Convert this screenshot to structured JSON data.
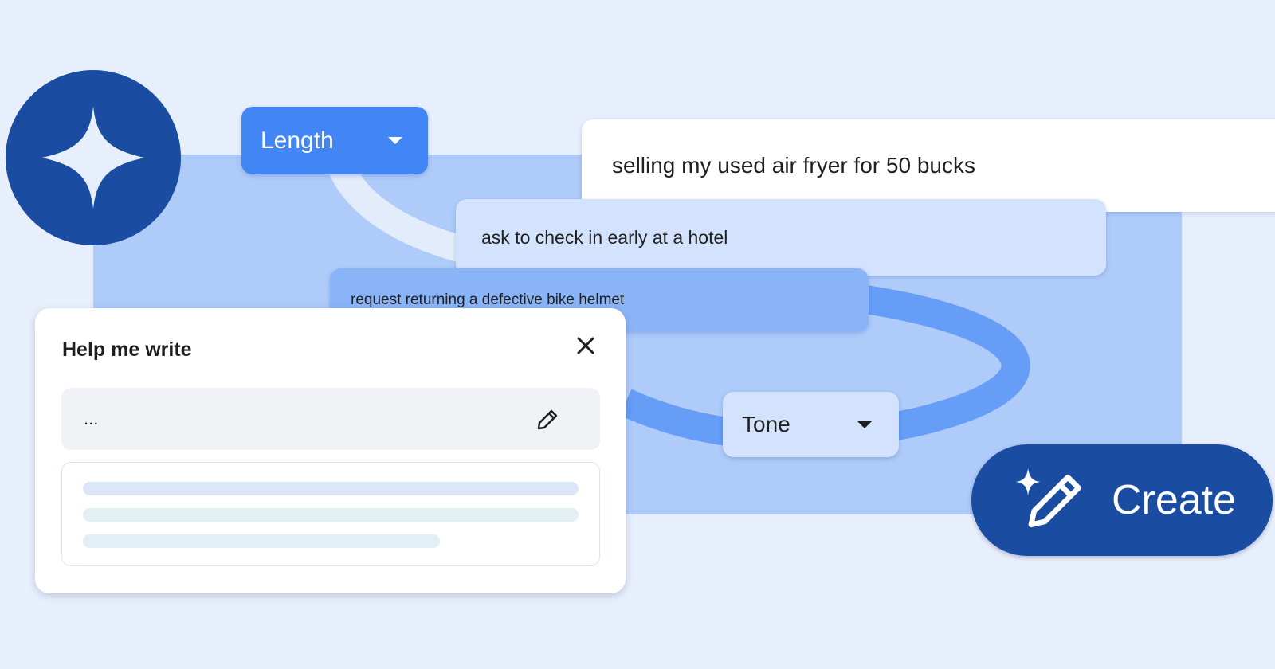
{
  "length_dropdown": {
    "label": "Length"
  },
  "prompts": [
    "selling my used air fryer for 50 bucks",
    "ask to check in early at a hotel",
    "request returning a defective bike helmet"
  ],
  "tone_dropdown": {
    "label": "Tone"
  },
  "create_button": {
    "label": "Create",
    "icon": "sparkle-pencil-icon"
  },
  "help_me_write": {
    "title": "Help me write",
    "close_icon": "close-icon",
    "input": {
      "value": "...",
      "icon": "pencil-icon"
    },
    "output_placeholder_lines": 3
  },
  "logo": {
    "icon": "sparkle-icon"
  },
  "colors": {
    "background": "#e8effc",
    "panel_blue": "#aecbfa",
    "dark_blue": "#1a4da2",
    "accent_blue": "#4285f4",
    "light_blue": "#d3e3fd",
    "mid_blue": "#8ab4f8"
  }
}
